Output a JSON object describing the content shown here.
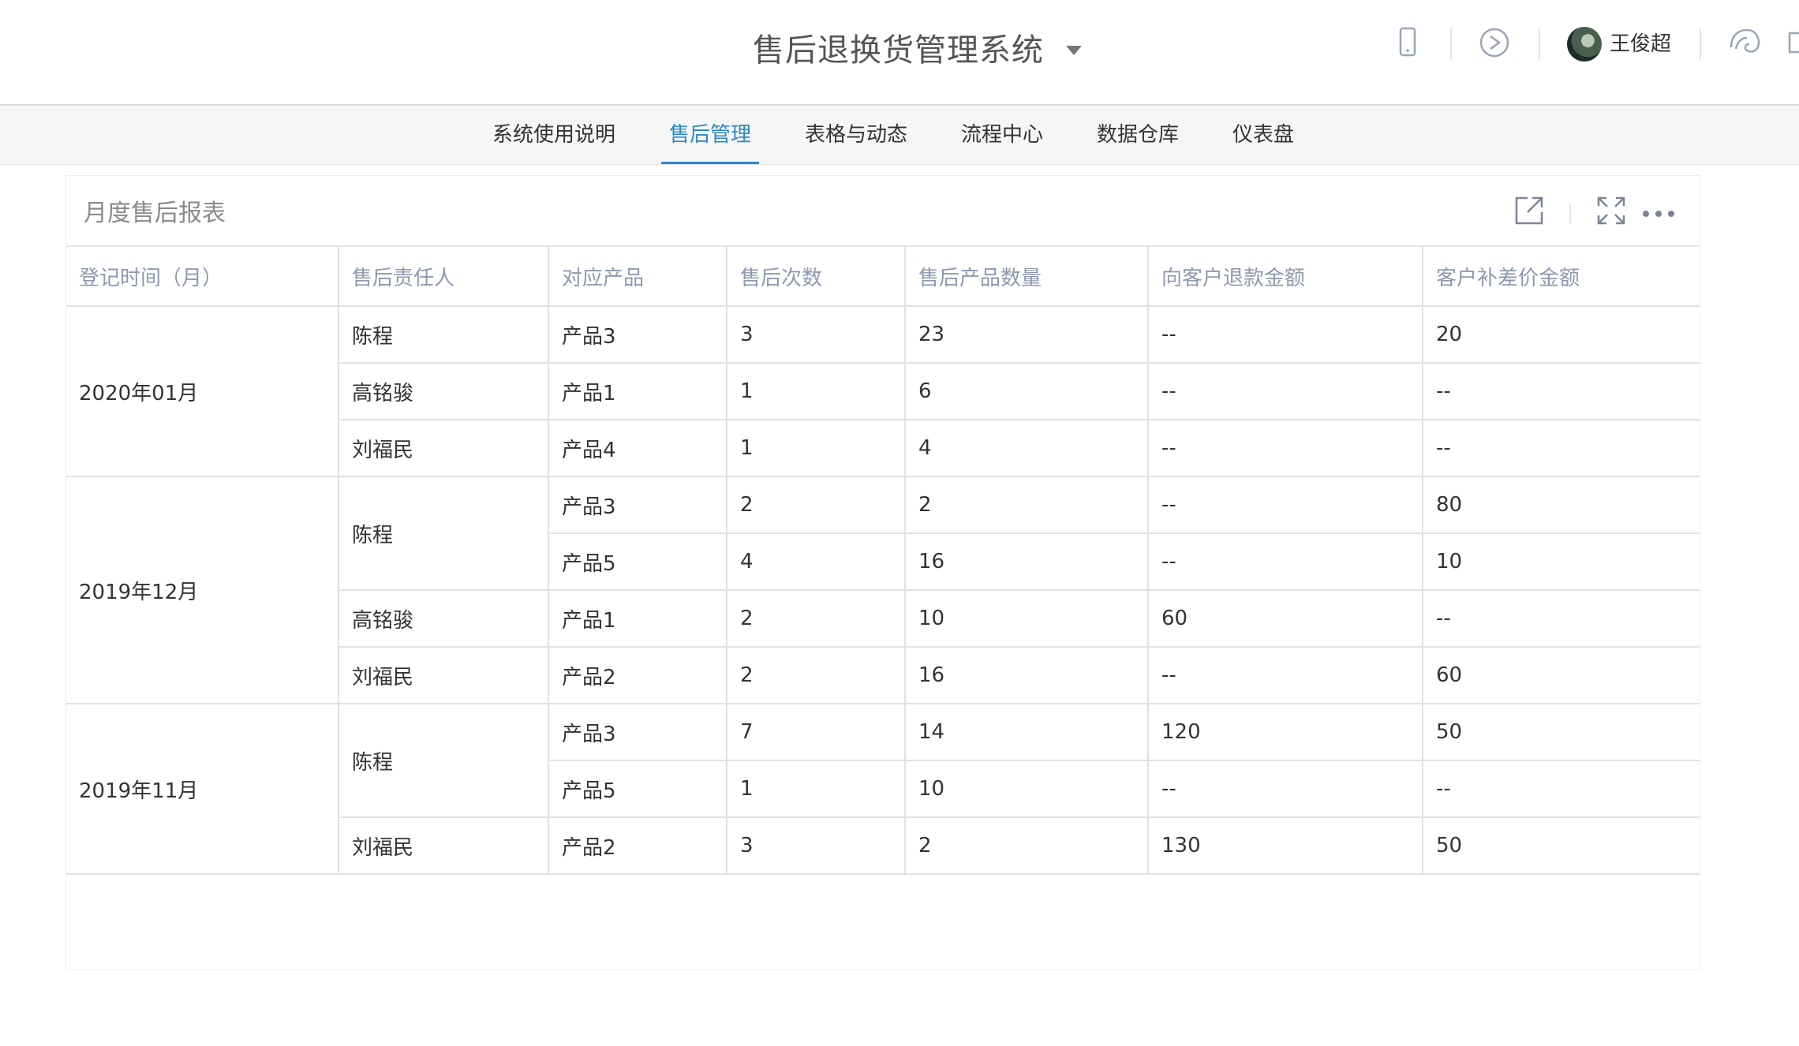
{
  "header": {
    "app_title": "售后退换货管理系统",
    "user_name": "王俊超",
    "icons": [
      "mobile-icon",
      "compass-icon",
      "user-avatar",
      "skin-icon",
      "logout-icon"
    ]
  },
  "nav": {
    "items": [
      {
        "label": "系统使用说明"
      },
      {
        "label": "售后管理"
      },
      {
        "label": "表格与动态"
      },
      {
        "label": "流程中心"
      },
      {
        "label": "数据仓库"
      },
      {
        "label": "仪表盘"
      }
    ],
    "active": "售后管理"
  },
  "panel": {
    "title": "月度售后报表",
    "icons": [
      "open-external-icon",
      "fullscreen-icon",
      "more-icon"
    ]
  },
  "table": {
    "columns": [
      "登记时间（月）",
      "售后责任人",
      "对应产品",
      "售后次数",
      "售后产品数量",
      "向客户退款金额",
      "客户补差价金额"
    ],
    "groups": [
      {
        "month": "2020年01月",
        "people": [
          {
            "name": "陈程",
            "rows": [
              {
                "product": "产品3",
                "count": "3",
                "qty": "23",
                "refund": "--",
                "diff": "20"
              }
            ]
          },
          {
            "name": "高铭骏",
            "rows": [
              {
                "product": "产品1",
                "count": "1",
                "qty": "6",
                "refund": "--",
                "diff": "--"
              }
            ]
          },
          {
            "name": "刘福民",
            "rows": [
              {
                "product": "产品4",
                "count": "1",
                "qty": "4",
                "refund": "--",
                "diff": "--"
              }
            ]
          }
        ]
      },
      {
        "month": "2019年12月",
        "people": [
          {
            "name": "陈程",
            "rows": [
              {
                "product": "产品3",
                "count": "2",
                "qty": "2",
                "refund": "--",
                "diff": "80"
              },
              {
                "product": "产品5",
                "count": "4",
                "qty": "16",
                "refund": "--",
                "diff": "10"
              }
            ]
          },
          {
            "name": "高铭骏",
            "rows": [
              {
                "product": "产品1",
                "count": "2",
                "qty": "10",
                "refund": "60",
                "diff": "--"
              }
            ]
          },
          {
            "name": "刘福民",
            "rows": [
              {
                "product": "产品2",
                "count": "2",
                "qty": "16",
                "refund": "--",
                "diff": "60"
              }
            ]
          }
        ]
      },
      {
        "month": "2019年11月",
        "people": [
          {
            "name": "陈程",
            "rows": [
              {
                "product": "产品3",
                "count": "7",
                "qty": "14",
                "refund": "120",
                "diff": "50"
              },
              {
                "product": "产品5",
                "count": "1",
                "qty": "10",
                "refund": "--",
                "diff": "--"
              }
            ]
          },
          {
            "name": "刘福民",
            "rows": [
              {
                "product": "产品2",
                "count": "3",
                "qty": "2",
                "refund": "130",
                "diff": "50"
              }
            ]
          }
        ]
      }
    ]
  }
}
